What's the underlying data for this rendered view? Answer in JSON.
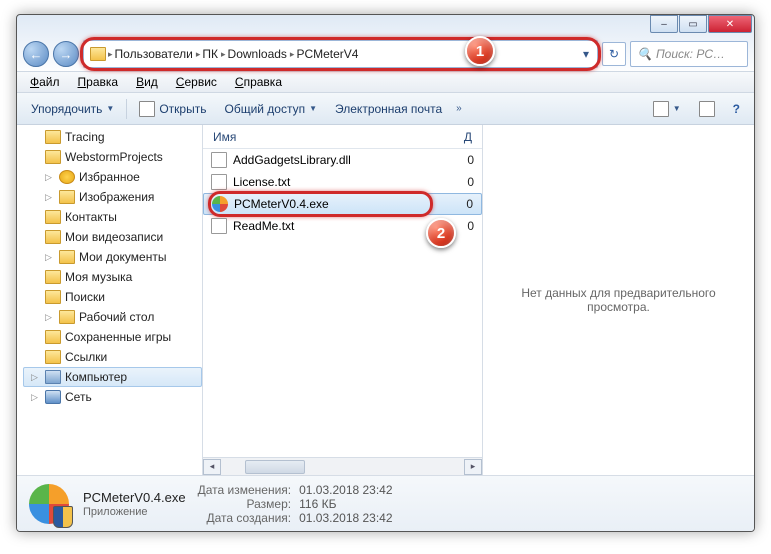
{
  "titlebar": {
    "min": "–",
    "max": "▭",
    "close": "✕"
  },
  "nav": {
    "back": "←",
    "forward": "→",
    "refresh": "↻",
    "dropdown": "▾"
  },
  "breadcrumbs": [
    {
      "label": "Пользователи"
    },
    {
      "label": "ПК"
    },
    {
      "label": "Downloads"
    },
    {
      "label": "PCMeterV4"
    }
  ],
  "search": {
    "placeholder": "Поиск: PC…",
    "icon": "🔍"
  },
  "menubar": [
    {
      "label": "Файл"
    },
    {
      "label": "Правка"
    },
    {
      "label": "Вид"
    },
    {
      "label": "Сервис"
    },
    {
      "label": "Справка"
    }
  ],
  "toolbar": {
    "organize": "Упорядочить",
    "open": "Открыть",
    "share": "Общий доступ",
    "email": "Электронная почта",
    "chev": "»"
  },
  "tree": {
    "items": [
      {
        "label": "Tracing",
        "type": "folder",
        "indent": 1
      },
      {
        "label": "WebstormProjects",
        "type": "folder",
        "indent": 1
      },
      {
        "label": "Избранное",
        "type": "star",
        "indent": 1,
        "exp": true
      },
      {
        "label": "Изображения",
        "type": "folder",
        "indent": 1,
        "exp": true
      },
      {
        "label": "Контакты",
        "type": "folder",
        "indent": 1
      },
      {
        "label": "Мои видеозаписи",
        "type": "folder",
        "indent": 1
      },
      {
        "label": "Мои документы",
        "type": "folder",
        "indent": 1,
        "exp": true
      },
      {
        "label": "Моя музыка",
        "type": "folder",
        "indent": 1
      },
      {
        "label": "Поиски",
        "type": "folder",
        "indent": 1
      },
      {
        "label": "Рабочий стол",
        "type": "folder",
        "indent": 1,
        "exp": true
      },
      {
        "label": "Сохраненные игры",
        "type": "folder",
        "indent": 1
      },
      {
        "label": "Ссылки",
        "type": "folder",
        "indent": 1
      }
    ],
    "computer": "Компьютер",
    "network": "Сеть"
  },
  "columns": {
    "name": "Имя",
    "date": "Д"
  },
  "files": [
    {
      "name": "AddGadgetsLibrary.dll",
      "type": "dll",
      "col2": "0"
    },
    {
      "name": "License.txt",
      "type": "txt",
      "col2": "0"
    },
    {
      "name": "PCMeterV0.4.exe",
      "type": "exe",
      "col2": "0",
      "selected": true
    },
    {
      "name": "ReadMe.txt",
      "type": "txt",
      "col2": "0"
    }
  ],
  "preview": {
    "text": "Нет данных для предварительного просмотра."
  },
  "details": {
    "filename": "PCMeterV0.4.exe",
    "filetype": "Приложение",
    "modified_label": "Дата изменения:",
    "modified": "01.03.2018 23:42",
    "size_label": "Размер:",
    "size": "116 КБ",
    "created_label": "Дата создания:",
    "created": "01.03.2018 23:42"
  },
  "callouts": {
    "one": "1",
    "two": "2"
  }
}
